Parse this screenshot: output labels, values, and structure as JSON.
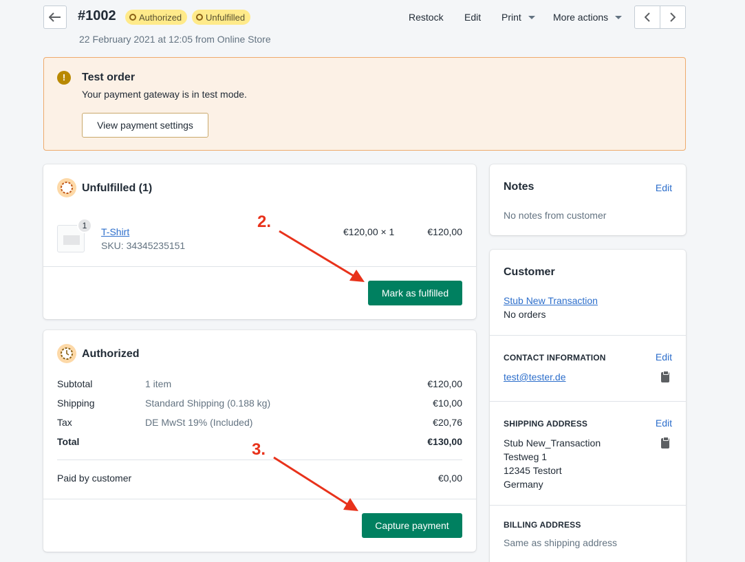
{
  "header": {
    "order_number": "#1002",
    "badges": [
      "Authorized",
      "Unfulfilled"
    ],
    "subtitle": "22 February 2021 at 12:05 from Online Store",
    "actions": {
      "restock": "Restock",
      "edit": "Edit",
      "print": "Print",
      "more": "More actions"
    }
  },
  "banner": {
    "title": "Test order",
    "text": "Your payment gateway is in test mode.",
    "button": "View payment settings"
  },
  "unfulfilled": {
    "title": "Unfulfilled (1)",
    "item": {
      "name": "T-Shirt",
      "sku": "SKU: 34345235151",
      "quantity_badge": "1",
      "unit_price": "€120,00 × 1",
      "total": "€120,00"
    },
    "button": "Mark as fulfilled"
  },
  "authorized": {
    "title": "Authorized",
    "rows": [
      {
        "label": "Subtotal",
        "detail": "1 item",
        "amount": "€120,00"
      },
      {
        "label": "Shipping",
        "detail": "Standard Shipping (0.188 kg)",
        "amount": "€10,00"
      },
      {
        "label": "Tax",
        "detail": "DE MwSt 19% (Included)",
        "amount": "€20,76"
      },
      {
        "label": "Total",
        "detail": "",
        "amount": "€130,00"
      }
    ],
    "paid_label": "Paid by customer",
    "paid_amount": "€0,00",
    "button": "Capture payment"
  },
  "notes": {
    "title": "Notes",
    "edit": "Edit",
    "text": "No notes from customer"
  },
  "customer": {
    "title": "Customer",
    "name": "Stub New Transaction",
    "orders": "No orders",
    "contact_heading": "CONTACT INFORMATION",
    "contact_edit": "Edit",
    "email": "test@tester.de",
    "shipping_heading": "SHIPPING ADDRESS",
    "shipping_edit": "Edit",
    "address": [
      "Stub New_Transaction",
      "Testweg 1",
      "12345 Testort",
      "Germany"
    ],
    "billing_heading": "BILLING ADDRESS",
    "billing_text": "Same as shipping address"
  },
  "annotations": [
    "2.",
    "3."
  ],
  "colors": {
    "primary": "#008060",
    "badge": "#ffea8a",
    "banner_bg": "#fcf1e6",
    "annotation": "#e8321b",
    "link": "#2c6ecb"
  }
}
